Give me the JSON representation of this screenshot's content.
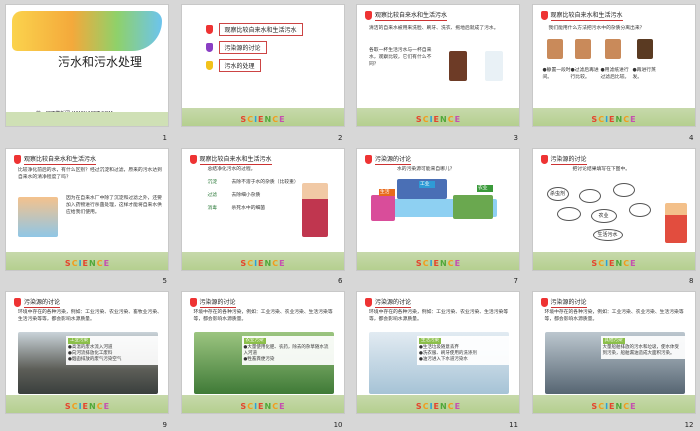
{
  "science_letters": [
    {
      "ch": "S",
      "color": "#e5432c"
    },
    {
      "ch": "C",
      "color": "#f29c1b"
    },
    {
      "ch": "I",
      "color": "#2aa0d8"
    },
    {
      "ch": "E",
      "color": "#e5432c"
    },
    {
      "ch": "N",
      "color": "#51a83a"
    },
    {
      "ch": "C",
      "color": "#f29c1b"
    },
    {
      "ch": "E",
      "color": "#c64fb0"
    }
  ],
  "slides": [
    {
      "num": "1",
      "title": "污水和污水处理",
      "subtitle": "第一PPT模板网-WWW.1PPT.COM"
    },
    {
      "num": "2",
      "toc": [
        "观察比较自来水和生活污水",
        "污染源的讨论",
        "污水的处理"
      ]
    },
    {
      "num": "3",
      "header": "观察比较自来水和生活污水",
      "text1": "清洁的自来水被用来洗脸、刷牙、洗衣、拖地后就成了污水。",
      "text2": "各取一杯生活污水与一杯自来水，观察比较，它们有什么不同？"
    },
    {
      "num": "4",
      "header": "观察比较自来水和生活污水",
      "question": "我们能用什么方法把污水中的杂质分离出来？",
      "steps": [
        "●静置一段时间。",
        "●过滤后再进行比较。",
        "●用滤纸进行过滤后比较。",
        "●再进行蒸发。"
      ]
    },
    {
      "num": "5",
      "header": "观察比较自来水和生活污水",
      "text1": "比较净化前后的水，有什么区别？经过沉淀和过滤，原来的污水达到自来水的清净程度了吗？",
      "text2": "因为在自来水厂中除了沉淀和过滤之外，还要加入药物进行杀菌处理，这样才能将自来水供应给我们使用。"
    },
    {
      "num": "6",
      "header": "观察比较自来水和生活污水",
      "intro": "总结净化污水的过程。",
      "steps": [
        {
          "k": "沉淀",
          "v": "去除不溶于水的杂质（比较重）"
        },
        {
          "k": "过滤",
          "v": "去除细小杂质"
        },
        {
          "k": "消毒",
          "v": "杀死水中的细菌"
        }
      ]
    },
    {
      "num": "7",
      "header": "污染源的讨论",
      "question": "水的污染源可能来自哪儿？",
      "labels": [
        "工业",
        "农业",
        "生活"
      ]
    },
    {
      "num": "8",
      "header": "污染源的讨论",
      "question": "把讨论结果填写在下图中。",
      "nodes": [
        "杀虫剂",
        "农业",
        "生活污水"
      ]
    },
    {
      "num": "9",
      "header": "污染源的讨论",
      "text": "环境中存在的各种污染，例如：工业污染、农业污染、畜牧业污染、生活污染等等，都会影响水源质量。",
      "caption_title": "工业污染",
      "caption": [
        "●高温的废水流入河道",
        "●向河流排放化工废料",
        "●烟囱排放的废气污染空气"
      ]
    },
    {
      "num": "10",
      "header": "污染源的讨论",
      "text": "环境中存在的各种污染，例如：工业污染、农业污染、生活污染等等，都会影响水源质量。",
      "caption_title": "农业污染",
      "caption": [
        "●大量使用化肥、农药，除去的杂草随水流入河道",
        "●牲畜粪便污染"
      ]
    },
    {
      "num": "11",
      "header": "污染源的讨论",
      "text": "环境中存在的各种污染，例如：工业污染、农业污染、生活污染等等，都会影响水源质量。",
      "caption_title": "生活污染",
      "caption": [
        "●生活垃圾随意丢弃",
        "●洗衣服、刷牙使用的洗涤剂",
        "●油污进入下水道污染水"
      ]
    },
    {
      "num": "12",
      "header": "污染源的讨论",
      "text": "环境中存在的各种污染，例如：工业污染、农业污染、生活污染等等，都会影响水源质量。",
      "caption_title": "其他污染",
      "caption": [
        "大量船舶排放的污水和垃圾，使水体受到污染，船舶漏油造成大面积污染。"
      ]
    }
  ]
}
